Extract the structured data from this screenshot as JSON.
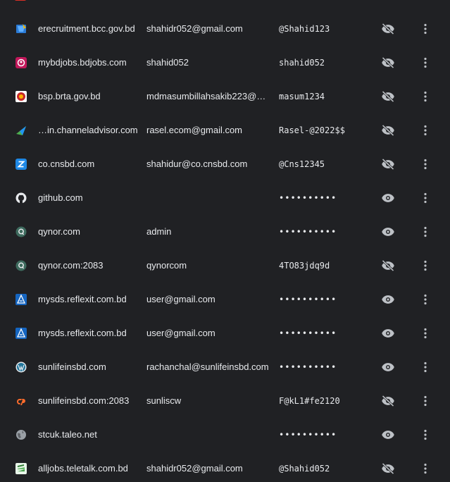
{
  "colors": {
    "background": "#202124",
    "text": "#e8eaed",
    "icon": "#bdc1c6"
  },
  "rows": [
    {
      "site": "erecruitment.bcc.gov.bd",
      "username": "shahidr052@gmail.com",
      "password": "@Shahid123",
      "favicon": "bcc-icon",
      "visible": true
    },
    {
      "site": "mybdjobs.bdjobs.com",
      "username": "shahid052",
      "password": "shahid052",
      "favicon": "bdjobs-icon",
      "visible": true
    },
    {
      "site": "bsp.brta.gov.bd",
      "username": "mdmasumbillahsakib223@g…",
      "password": "masum1234",
      "favicon": "brta-icon",
      "visible": true
    },
    {
      "site": "…in.channeladvisor.com",
      "username": "rasel.ecom@gmail.com",
      "password": "Rasel-@2022$$",
      "favicon": "channeladvisor-icon",
      "visible": true
    },
    {
      "site": "co.cnsbd.com",
      "username": "shahidur@co.cnsbd.com",
      "password": "@Cns12345",
      "favicon": "cnsbd-icon",
      "visible": true
    },
    {
      "site": "github.com",
      "username": "",
      "password": "••••••••••",
      "favicon": "github-icon",
      "visible": false
    },
    {
      "site": "qynor.com",
      "username": "admin",
      "password": "••••••••••",
      "favicon": "qynor-icon",
      "visible": false
    },
    {
      "site": "qynor.com:2083",
      "username": "qynorcom",
      "password": "4TO83jdq9d",
      "favicon": "qynor-icon",
      "visible": true
    },
    {
      "site": "mysds.reflexit.com.bd",
      "username": "user@gmail.com",
      "password": "••••••••••",
      "favicon": "reflexit-icon",
      "visible": false
    },
    {
      "site": "mysds.reflexit.com.bd",
      "username": "user@gmail.com",
      "password": "••••••••••",
      "favicon": "reflexit-icon",
      "visible": false
    },
    {
      "site": "sunlifeinsbd.com",
      "username": "rachanchal@sunlifeinsbd.com",
      "password": "••••••••••",
      "favicon": "wordpress-icon",
      "visible": false
    },
    {
      "site": "sunlifeinsbd.com:2083",
      "username": "sunliscw",
      "password": "F@kL1#fe2120",
      "favicon": "cpanel-icon",
      "visible": true
    },
    {
      "site": "stcuk.taleo.net",
      "username": "",
      "password": "••••••••••",
      "favicon": "globe-icon",
      "visible": false
    },
    {
      "site": "alljobs.teletalk.com.bd",
      "username": "shahidr052@gmail.com",
      "password": "@Shahid052",
      "favicon": "teletalk-icon",
      "visible": true
    }
  ]
}
